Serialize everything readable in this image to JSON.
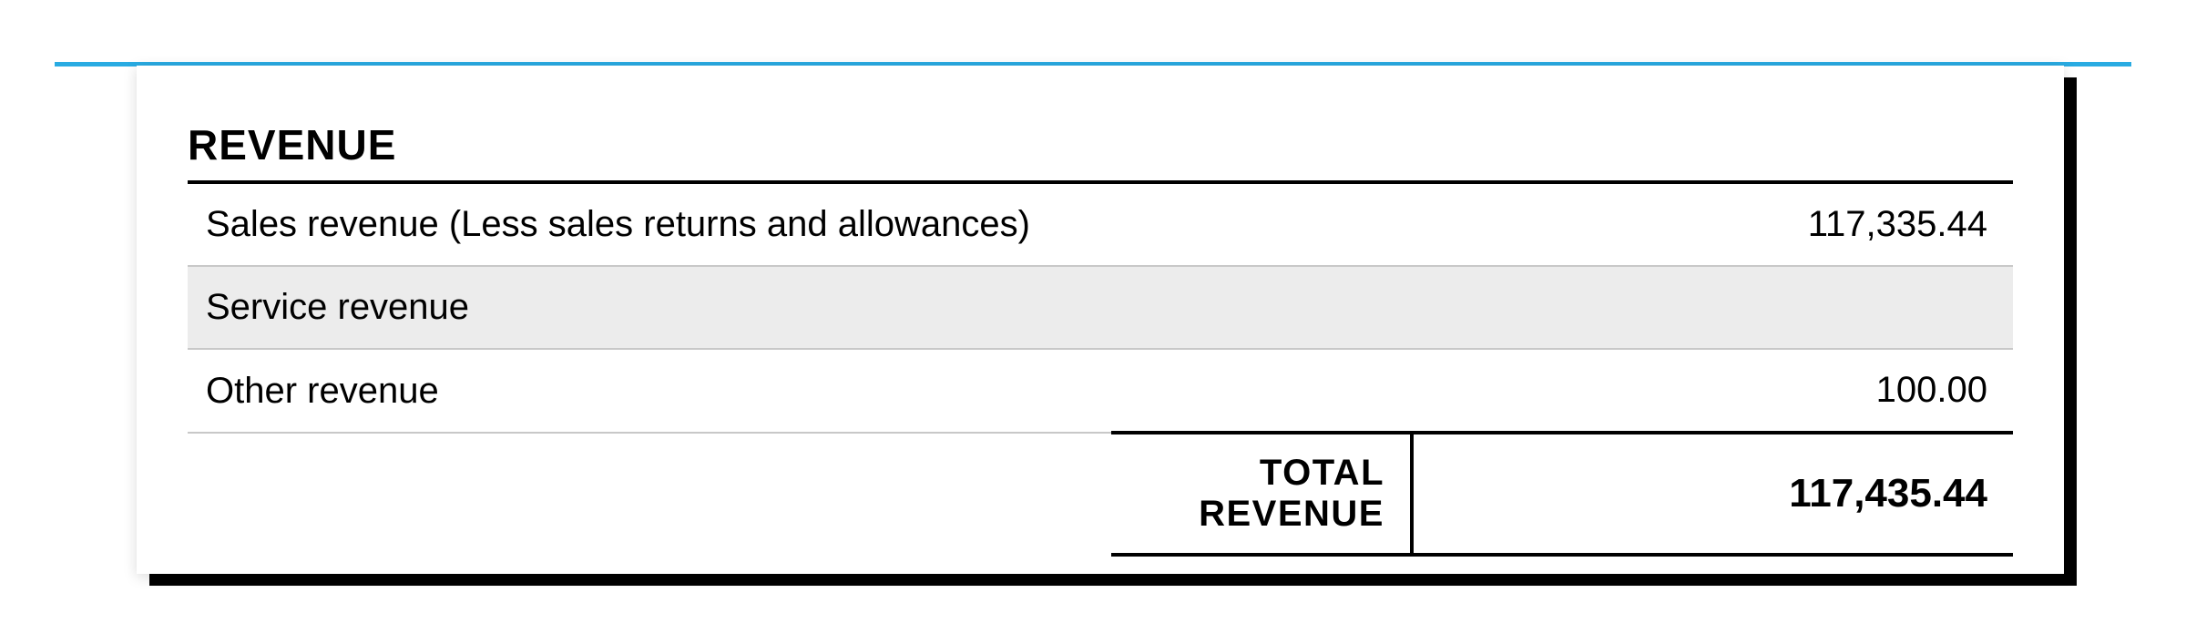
{
  "section": {
    "title": "REVENUE"
  },
  "rows": [
    {
      "label": "Sales revenue (Less sales returns and allowances)",
      "value": "117,335.44"
    },
    {
      "label": "Service revenue",
      "value": ""
    },
    {
      "label": "Other revenue",
      "value": "100.00"
    }
  ],
  "total": {
    "label": "TOTAL REVENUE",
    "value": "117,435.44"
  }
}
